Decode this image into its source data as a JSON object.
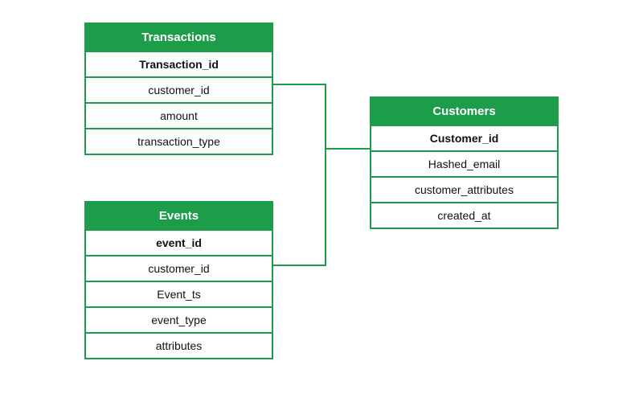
{
  "diagram": {
    "entities": {
      "transactions": {
        "title": "Transactions",
        "primary_key": "Transaction_id",
        "columns": [
          "customer_id",
          "amount",
          "transaction_type"
        ]
      },
      "events": {
        "title": "Events",
        "primary_key": "event_id",
        "columns": [
          "customer_id",
          "Event_ts",
          "event_type",
          "attributes"
        ]
      },
      "customers": {
        "title": "Customers",
        "primary_key": "Customer_id",
        "columns": [
          "Hashed_email",
          "customer_attributes",
          "created_at"
        ]
      }
    },
    "relationships": [
      {
        "from": "transactions.customer_id",
        "to": "customers.Customer_id"
      },
      {
        "from": "events.customer_id",
        "to": "customers.Customer_id"
      }
    ],
    "colors": {
      "accent": "#1d9c4a",
      "background": "#ffffff"
    }
  }
}
